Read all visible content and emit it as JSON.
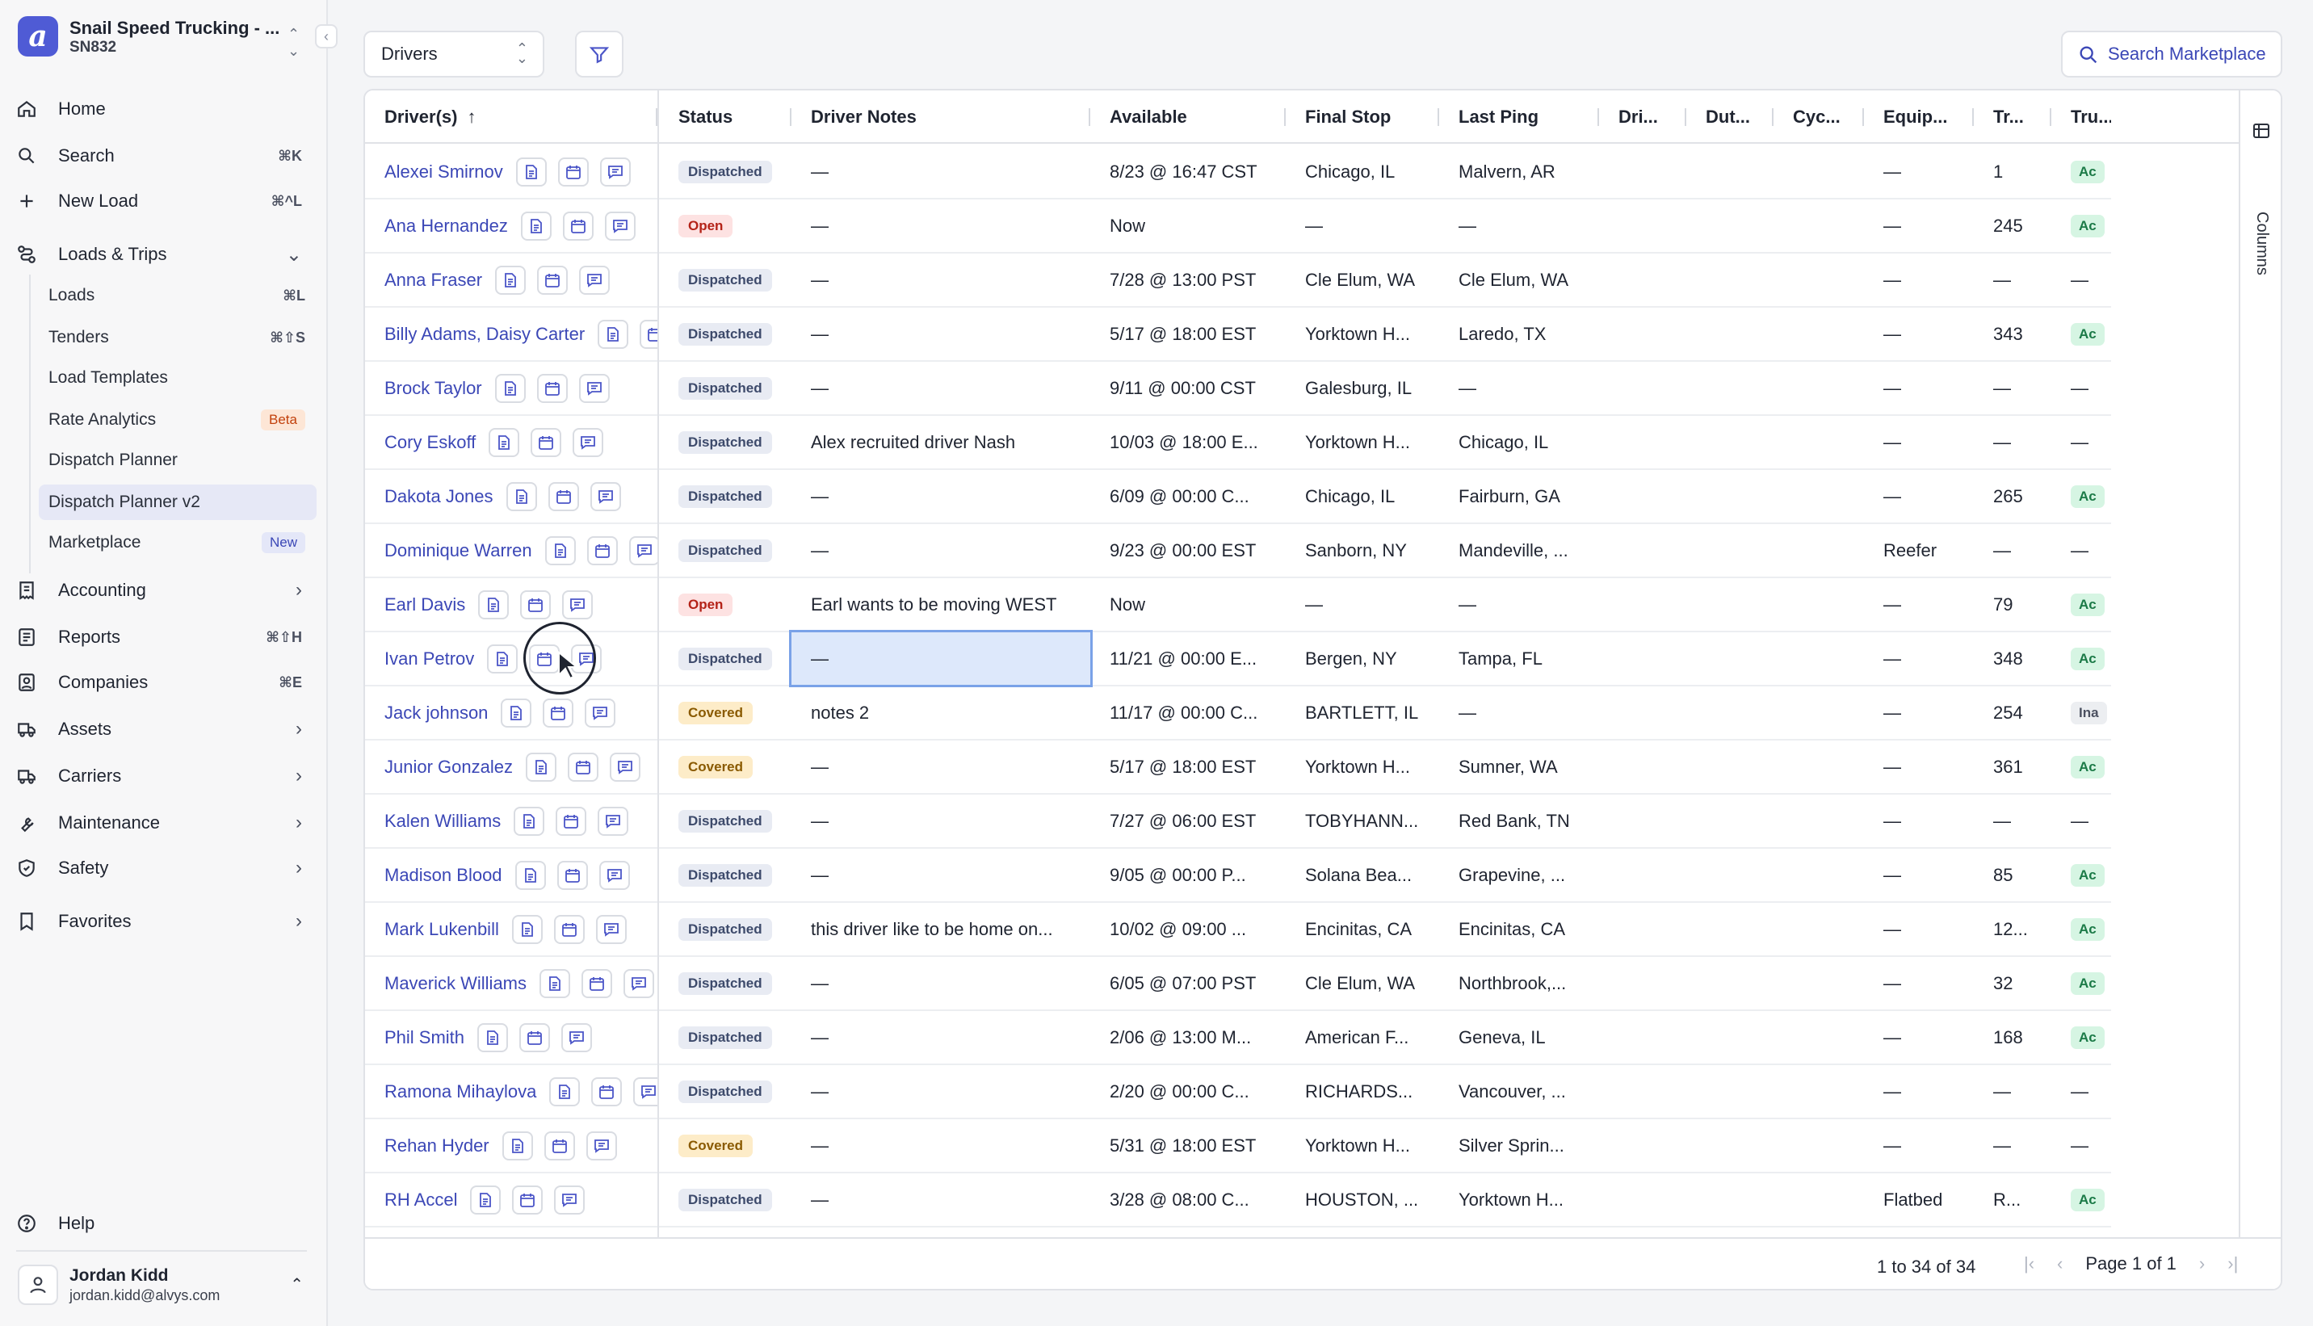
{
  "org": {
    "name": "Snail Speed Trucking - ...",
    "code": "SN832",
    "logo_letter": "a"
  },
  "nav": {
    "home": "Home",
    "search": {
      "label": "Search",
      "kbd": "⌘K"
    },
    "new_load": {
      "label": "New Load",
      "kbd": "⌘^L"
    },
    "loads_trips": "Loads & Trips",
    "sub": [
      {
        "label": "Loads",
        "kbd": "⌘L"
      },
      {
        "label": "Tenders",
        "kbd": "⌘⇧S"
      },
      {
        "label": "Load Templates"
      },
      {
        "label": "Rate Analytics",
        "badge": "Beta"
      },
      {
        "label": "Dispatch Planner"
      },
      {
        "label": "Dispatch Planner v2"
      },
      {
        "label": "Marketplace",
        "badge": "New"
      }
    ],
    "accounting": "Accounting",
    "reports": {
      "label": "Reports",
      "kbd": "⌘⇧H"
    },
    "companies": {
      "label": "Companies",
      "kbd": "⌘E"
    },
    "assets": "Assets",
    "carriers": "Carriers",
    "maintenance": "Maintenance",
    "safety": "Safety",
    "favorites": "Favorites",
    "help": "Help"
  },
  "user": {
    "name": "Jordan Kidd",
    "email": "jordan.kidd@alvys.com"
  },
  "toolbar": {
    "view": "Drivers",
    "market": "Search Marketplace"
  },
  "columns": [
    "Driver(s)",
    "Status",
    "Driver Notes",
    "Available",
    "Final Stop",
    "Last Ping",
    "Dri...",
    "Dut...",
    "Cyc...",
    "Equip...",
    "Tr...",
    "Tru..."
  ],
  "columns_panel": "Columns",
  "rows": [
    {
      "name": "Alexei Smirnov",
      "status": "Dispatched",
      "notes": "—",
      "available": "8/23 @ 16:47 CST",
      "final_stop": "Chicago, IL",
      "last_ping": "Malvern, AR",
      "equip": "—",
      "tr": "1",
      "tru": "Ac"
    },
    {
      "name": "Ana Hernandez",
      "status": "Open",
      "notes": "—",
      "available": "Now",
      "final_stop": "—",
      "last_ping": "—",
      "equip": "—",
      "tr": "245",
      "tru": "Ac"
    },
    {
      "name": "Anna Fraser",
      "status": "Dispatched",
      "notes": "—",
      "available": "7/28 @ 13:00 PST",
      "final_stop": "Cle Elum, WA",
      "last_ping": "Cle Elum, WA",
      "equip": "—",
      "tr": "—",
      "tru": "—"
    },
    {
      "name": "Billy Adams, Daisy Carter",
      "status": "Dispatched",
      "notes": "—",
      "available": "5/17 @ 18:00 EST",
      "final_stop": "Yorktown H...",
      "last_ping": "Laredo, TX",
      "equip": "—",
      "tr": "343",
      "tru": "Ac"
    },
    {
      "name": "Brock Taylor",
      "status": "Dispatched",
      "notes": "—",
      "available": "9/11 @ 00:00 CST",
      "final_stop": "Galesburg, IL",
      "last_ping": "—",
      "equip": "—",
      "tr": "—",
      "tru": "—"
    },
    {
      "name": "Cory Eskoff",
      "status": "Dispatched",
      "notes": "Alex recruited driver Nash",
      "available": "10/03 @ 18:00 E...",
      "final_stop": "Yorktown H...",
      "last_ping": "Chicago, IL",
      "equip": "—",
      "tr": "—",
      "tru": "—"
    },
    {
      "name": "Dakota Jones",
      "status": "Dispatched",
      "notes": "—",
      "available": "6/09 @ 00:00 C...",
      "final_stop": "Chicago, IL",
      "last_ping": "Fairburn, GA",
      "equip": "—",
      "tr": "265",
      "tru": "Ac"
    },
    {
      "name": "Dominique Warren",
      "status": "Dispatched",
      "notes": "—",
      "available": "9/23 @ 00:00 EST",
      "final_stop": "Sanborn, NY",
      "last_ping": "Mandeville, ...",
      "equip": "Reefer",
      "tr": "—",
      "tru": "—"
    },
    {
      "name": "Earl Davis",
      "status": "Open",
      "notes": "Earl wants to be moving WEST",
      "available": "Now",
      "final_stop": "—",
      "last_ping": "—",
      "equip": "—",
      "tr": "79",
      "tru": "Ac"
    },
    {
      "name": "Ivan Petrov",
      "status": "Dispatched",
      "notes": "—",
      "available": "11/21 @ 00:00 E...",
      "final_stop": "Bergen, NY",
      "last_ping": "Tampa, FL",
      "equip": "—",
      "tr": "348",
      "tru": "Ac"
    },
    {
      "name": "Jack johnson",
      "status": "Covered",
      "notes": "notes 2",
      "available": "11/17 @ 00:00 C...",
      "final_stop": "BARTLETT, IL",
      "last_ping": "—",
      "equip": "—",
      "tr": "254",
      "tru": "Ina"
    },
    {
      "name": "Junior Gonzalez",
      "status": "Covered",
      "notes": "—",
      "available": "5/17 @ 18:00 EST",
      "final_stop": "Yorktown H...",
      "last_ping": "Sumner, WA",
      "equip": "—",
      "tr": "361",
      "tru": "Ac"
    },
    {
      "name": "Kalen Williams",
      "status": "Dispatched",
      "notes": "—",
      "available": "7/27 @ 06:00 EST",
      "final_stop": "TOBYHANN...",
      "last_ping": "Red Bank, TN",
      "equip": "—",
      "tr": "—",
      "tru": "—"
    },
    {
      "name": "Madison Blood",
      "status": "Dispatched",
      "notes": "—",
      "available": "9/05 @ 00:00 P...",
      "final_stop": "Solana Bea...",
      "last_ping": "Grapevine, ...",
      "equip": "—",
      "tr": "85",
      "tru": "Ac"
    },
    {
      "name": "Mark Lukenbill",
      "status": "Dispatched",
      "notes": "this driver like to be home on...",
      "available": "10/02 @ 09:00 ...",
      "final_stop": "Encinitas, CA",
      "last_ping": "Encinitas, CA",
      "equip": "—",
      "tr": "12...",
      "tru": "Ac"
    },
    {
      "name": "Maverick Williams",
      "status": "Dispatched",
      "notes": "—",
      "available": "6/05 @ 07:00 PST",
      "final_stop": "Cle Elum, WA",
      "last_ping": "Northbrook,...",
      "equip": "—",
      "tr": "32",
      "tru": "Ac"
    },
    {
      "name": "Phil Smith",
      "status": "Dispatched",
      "notes": "—",
      "available": "2/06 @ 13:00 M...",
      "final_stop": "American F...",
      "last_ping": "Geneva, IL",
      "equip": "—",
      "tr": "168",
      "tru": "Ac"
    },
    {
      "name": "Ramona Mihaylova",
      "status": "Dispatched",
      "notes": "—",
      "available": "2/20 @ 00:00 C...",
      "final_stop": "RICHARDS...",
      "last_ping": "Vancouver, ...",
      "equip": "—",
      "tr": "—",
      "tru": "—"
    },
    {
      "name": "Rehan Hyder",
      "status": "Covered",
      "notes": "—",
      "available": "5/31 @ 18:00 EST",
      "final_stop": "Yorktown H...",
      "last_ping": "Silver Sprin...",
      "equip": "—",
      "tr": "—",
      "tru": "—"
    },
    {
      "name": "RH Accel",
      "status": "Dispatched",
      "notes": "—",
      "available": "3/28 @ 08:00 C...",
      "final_stop": "HOUSTON, ...",
      "last_ping": "Yorktown H...",
      "equip": "Flatbed",
      "tr": "R...",
      "tru": "Ac"
    }
  ],
  "footer": {
    "count": "1 to 34 of 34",
    "page": "Page 1 of 1"
  },
  "colors": {
    "accent": "#3b47b6",
    "brand": "#4f5bd5"
  }
}
